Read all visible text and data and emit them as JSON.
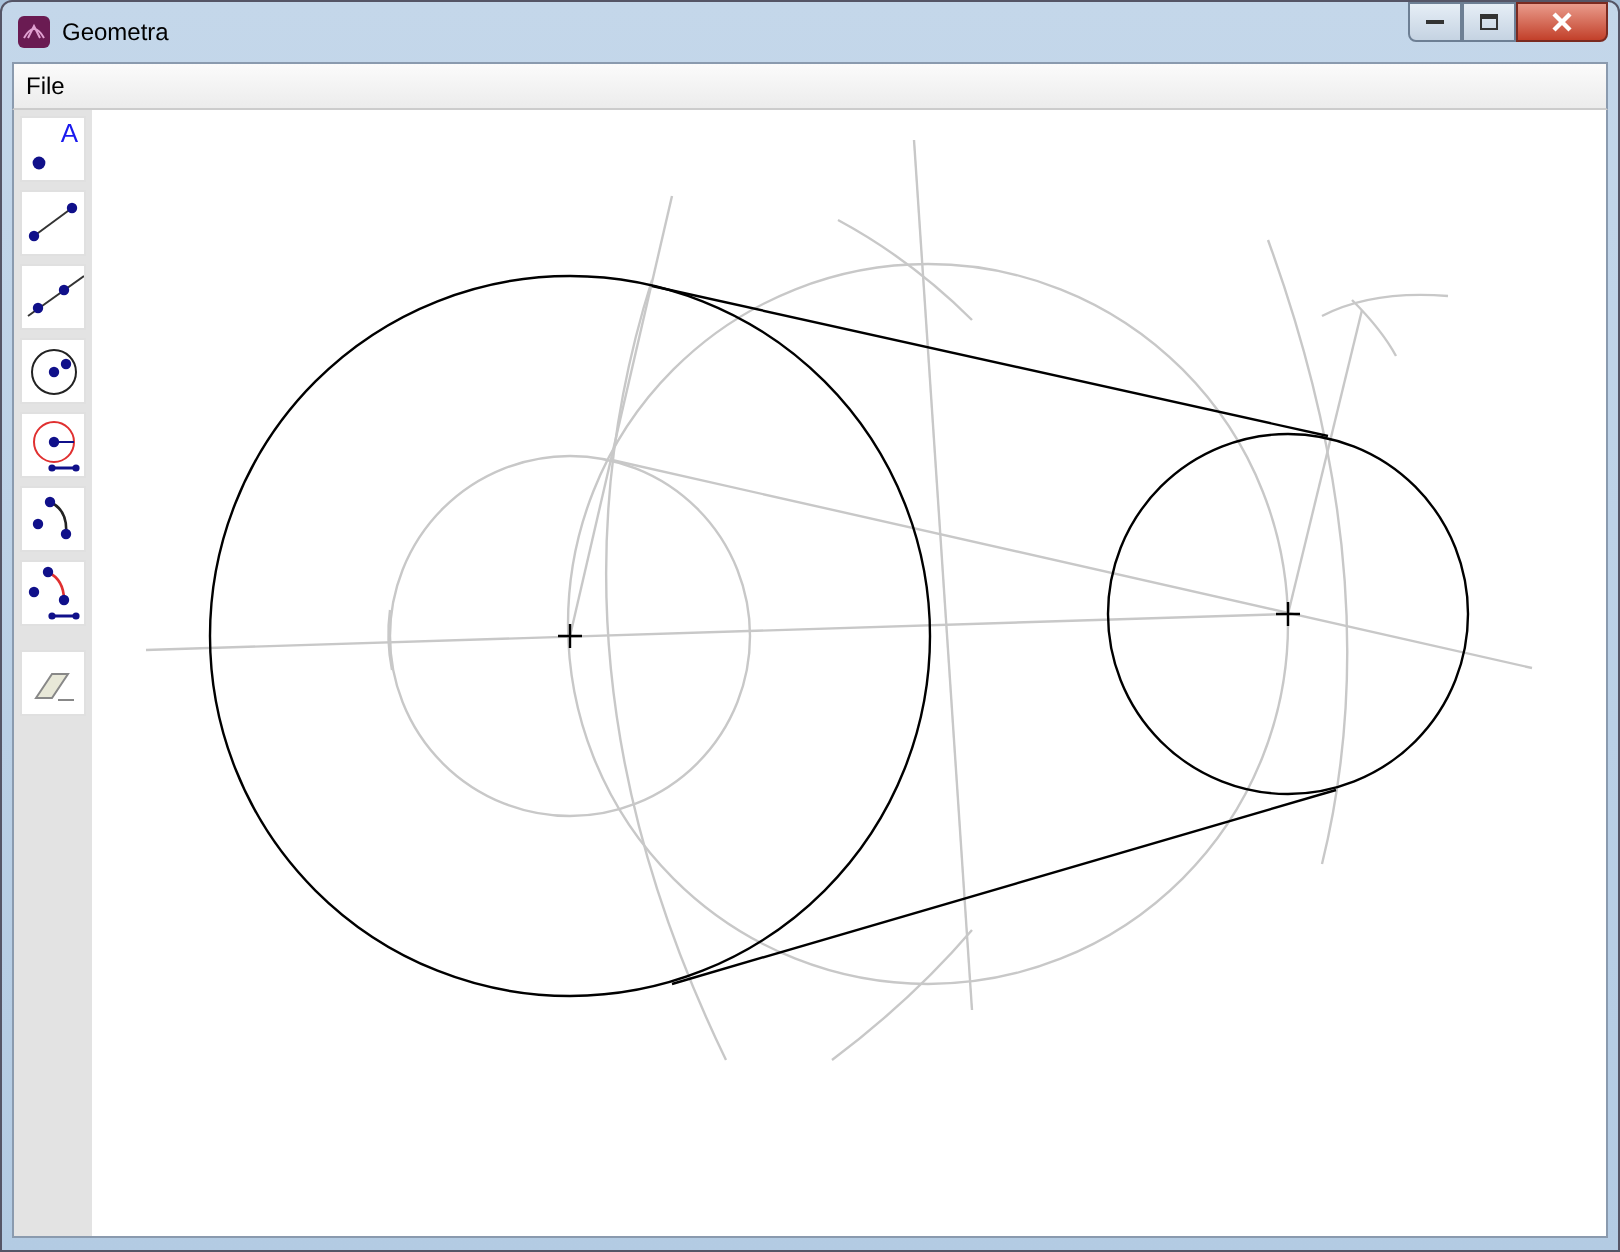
{
  "window": {
    "title": "Geometra"
  },
  "menu": [
    {
      "label": "File"
    }
  ],
  "tools": [
    {
      "kind": "point",
      "label": "A"
    },
    {
      "kind": "segment"
    },
    {
      "kind": "line"
    },
    {
      "kind": "circle"
    },
    {
      "kind": "circle-radius"
    },
    {
      "kind": "arc"
    },
    {
      "kind": "arc-radius"
    },
    {
      "kind": "eraser"
    }
  ]
}
